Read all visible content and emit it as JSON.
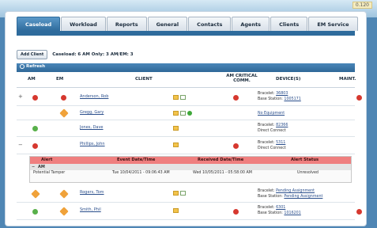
{
  "version": "0.120",
  "tabs": [
    "Caseload",
    "Workload",
    "Reports",
    "General",
    "Contacts",
    "Agents",
    "Clients",
    "EM Service"
  ],
  "toolbar": {
    "add_client": "Add Client",
    "caseload_summary": "Caseload: 6  AM Only: 3  AM/EM: 3"
  },
  "refresh_label": "Refresh",
  "headers": {
    "am": "AM",
    "em": "EM",
    "client": "CLIENT",
    "am_critical": "AM CRITICAL COMM.",
    "devices": "DEVICE(S)",
    "maint": "MAINT."
  },
  "rows": [
    {
      "name": "Anderson, Rob",
      "d1l": "Bracelet:",
      "d1v": "36803",
      "d2l": "Base Station:",
      "d2v": "1005171"
    },
    {
      "name": "Gregg, Gary",
      "d1l": "",
      "d1v": "No Equipment",
      "d2l": "",
      "d2v": ""
    },
    {
      "name": "Jones, Dave",
      "d1l": "Bracelet:",
      "d1v": "82366",
      "d2l": "Direct Connect",
      "d2v": ""
    },
    {
      "name": "Phillips, John",
      "d1l": "Bracelet:",
      "d1v": "5311",
      "d2l": "Direct Connect",
      "d2v": ""
    },
    {
      "name": "Rogers, Tom",
      "d1l": "Bracelet:",
      "d1v": "Pending Assignment",
      "d2l": "Base Station:",
      "d2v": "Pending Assignment"
    },
    {
      "name": "Smith, Phil",
      "d1l": "Bracelet:",
      "d1v": "6301",
      "d2l": "Base Station:",
      "d2v": "1016201"
    }
  ],
  "alert": {
    "h_alert": "Alert",
    "h_event": "Event Date/Time",
    "h_received": "Received Date/Time",
    "h_status": "Alert Status",
    "group": "AM",
    "type": "Potential Tamper",
    "event": "Tue   10/04/2011 - 09:06:43 AM",
    "received": "Wed   10/05/2011 - 05:58:00 AM",
    "status": "Unresolved"
  }
}
